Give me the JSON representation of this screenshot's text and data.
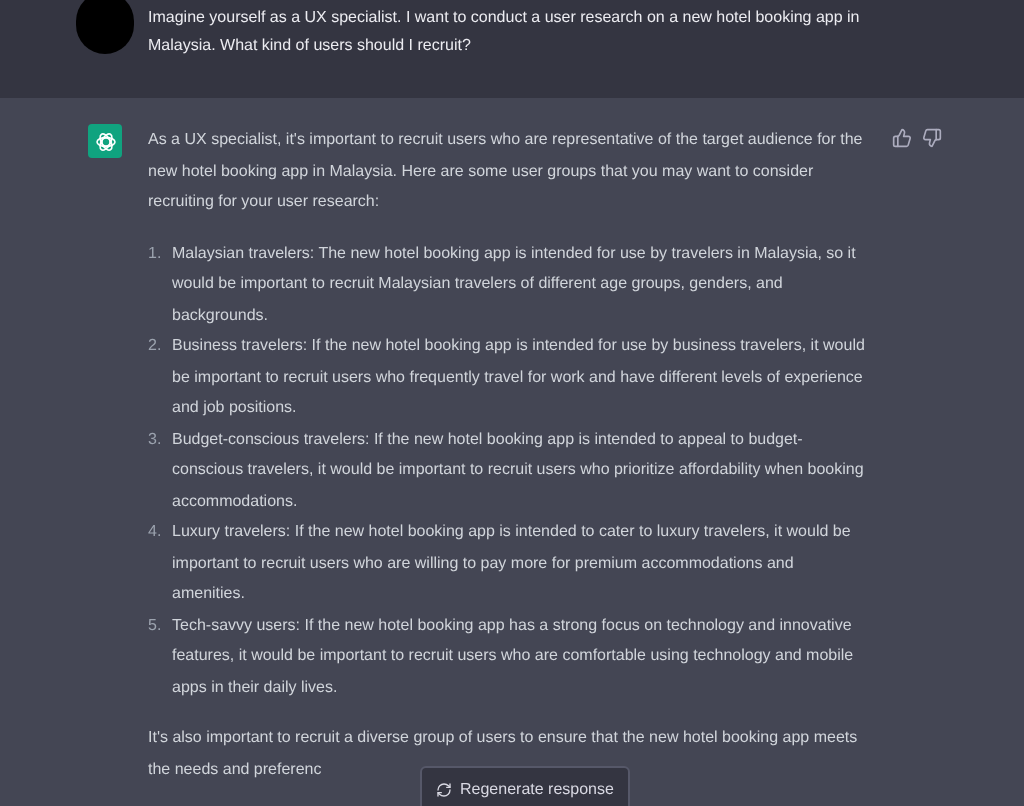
{
  "user_message": {
    "text": "Imagine yourself as a UX specialist. I want to conduct a user research on a new hotel booking app in Malaysia. What kind of users should I recruit?"
  },
  "assistant_message": {
    "intro": "As a UX specialist, it's important to recruit users who are representative of the target audience for the new hotel booking app in Malaysia. Here are some user groups that you may want to consider recruiting for your user research:",
    "items": [
      {
        "number": "1.",
        "text": "Malaysian travelers: The new hotel booking app is intended for use by travelers in Malaysia, so it would be important to recruit Malaysian travelers of different age groups, genders, and backgrounds."
      },
      {
        "number": "2.",
        "text": "Business travelers: If the new hotel booking app is intended for use by business travelers, it would be important to recruit users who frequently travel for work and have different levels of experience and job positions."
      },
      {
        "number": "3.",
        "text": "Budget-conscious travelers: If the new hotel booking app is intended to appeal to budget-conscious travelers, it would be important to recruit users who prioritize affordability when booking accommodations."
      },
      {
        "number": "4.",
        "text": "Luxury travelers: If the new hotel booking app is intended to cater to luxury travelers, it would be important to recruit users who are willing to pay more for premium accommodations and amenities."
      },
      {
        "number": "5.",
        "text": "Tech-savvy users: If the new hotel booking app has a strong focus on technology and innovative features, it would be important to recruit users who are comfortable using technology and mobile apps in their daily lives."
      }
    ],
    "outro": "It's also important to recruit a diverse group of users to ensure that the new hotel booking app meets the needs and preferenc"
  },
  "regenerate_button": {
    "label": "Regenerate response"
  }
}
